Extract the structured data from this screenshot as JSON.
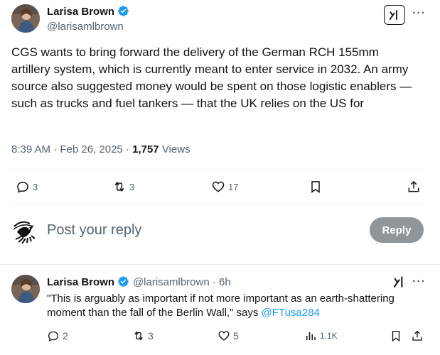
{
  "tweet": {
    "author_name": "Larisa Brown",
    "author_handle": "@larisamlbrown",
    "text": "CGS wants to bring forward the delivery of the German RCH 155mm artillery system, which is currently meant to enter service in 2032. An army source also suggested money would be spent on those logistic enablers — such as trucks and fuel tankers — that the UK relies on the US for",
    "timestamp": "8:39 AM · Feb 26, 2025 · ",
    "views_count": "1,757",
    "views_label": " Views",
    "actions": {
      "replies": "3",
      "reposts": "3",
      "likes": "17"
    }
  },
  "composer": {
    "placeholder": "Post your reply",
    "reply_button": "Reply"
  },
  "reply_tweet": {
    "author_name": "Larisa Brown",
    "author_handle": "@larisamlbrown",
    "time": " · 6h",
    "text": "\"This is arguably as important if not more important as an earth-shattering moment than the fall of the Berlin Wall,\" says ",
    "mention": "@FTusa284",
    "actions": {
      "replies": "2",
      "reposts": "3",
      "likes": "5",
      "views": "1.1K"
    }
  },
  "icons": {
    "verified": "verified-badge-icon",
    "grok": "grok-icon",
    "more": "more-icon",
    "reply": "reply-icon",
    "repost": "repost-icon",
    "like": "heart-icon",
    "bookmark": "bookmark-icon",
    "share": "share-icon",
    "views": "views-icon"
  },
  "colors": {
    "accent": "#1d9bf0",
    "text": "#0f1419",
    "muted": "#536471",
    "reply_button": "#8f9599"
  }
}
